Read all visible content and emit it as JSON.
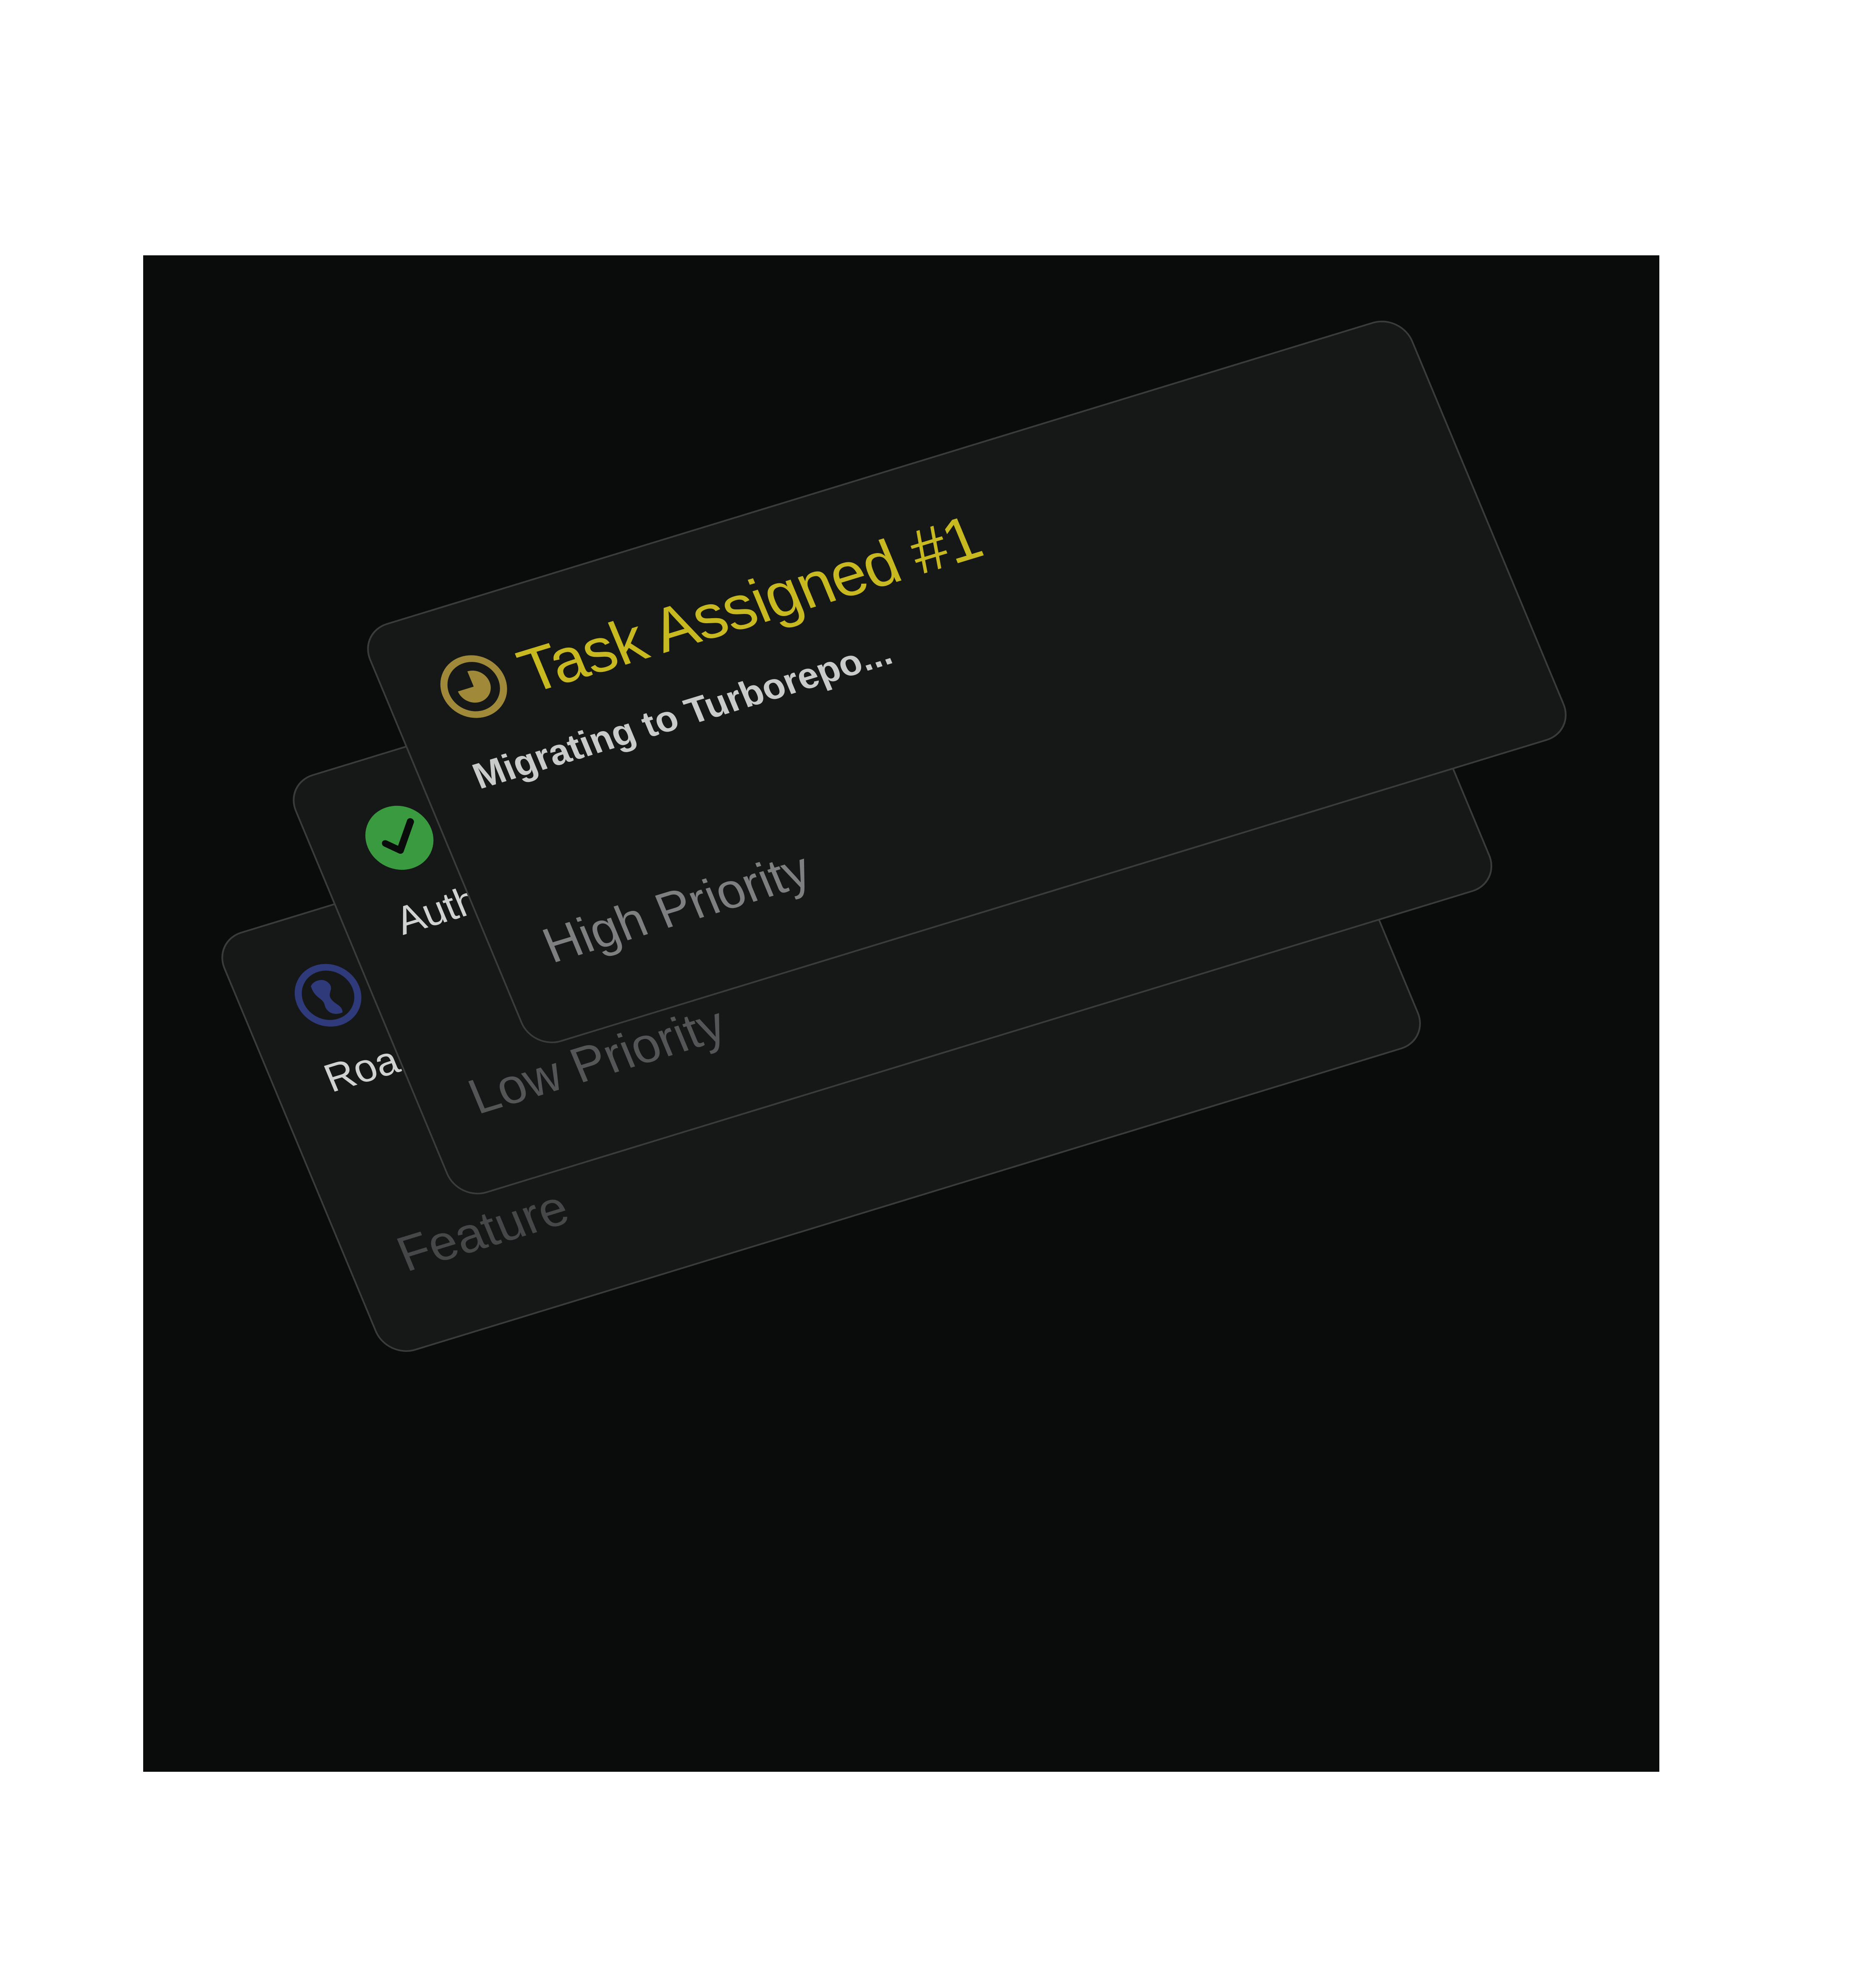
{
  "cards": [
    {
      "icon": "roadmap-globe-icon",
      "label": "Road",
      "tag": "Feature",
      "accent": "#2f3a7a"
    },
    {
      "icon": "check-icon",
      "label": "Auth",
      "tag": "Low Priority",
      "accent": "#3a9a3f"
    },
    {
      "icon": "in-progress-clock-icon",
      "title": "Task Assigned #1",
      "subtitle": "Migrating to Turborepo...",
      "tag": "High Priority",
      "accent": "#a08a3a",
      "title_color": "#c7b91f"
    }
  ]
}
